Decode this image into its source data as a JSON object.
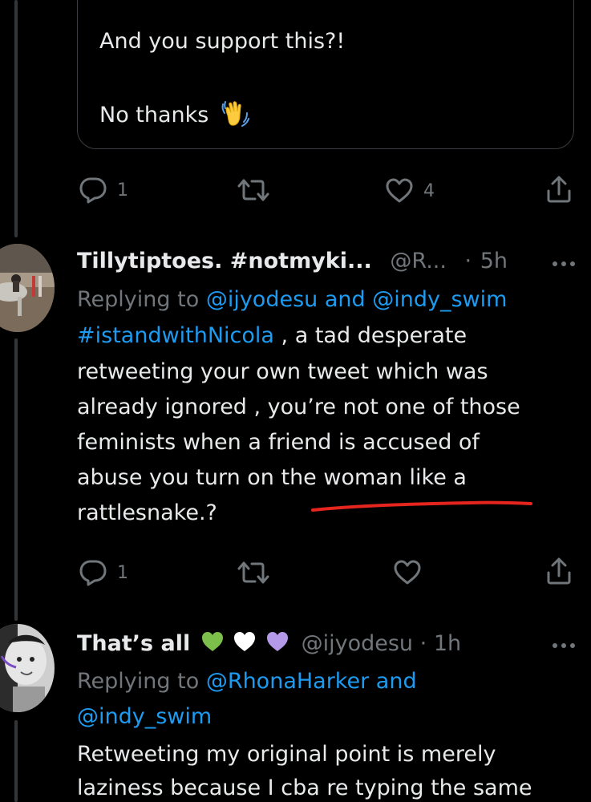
{
  "quoted_tweet": {
    "line1": "And you support this?!",
    "line2": "No thanks",
    "emoji": "waving-hand-icon"
  },
  "tweet1_actions": {
    "reply_count": "1",
    "like_count": "4"
  },
  "tweet2": {
    "name": "Tillytiptoes. #notmyki...",
    "handle": "@R...",
    "separator": "·",
    "time": "5h",
    "replying_label": "Replying to",
    "replying_user1": "@ijyodesu",
    "replying_and": "and",
    "replying_user2": "@indy_swim",
    "hashtag": "#istandwithNicola",
    "lines": [
      " , a tad desperate",
      "retweeting your own tweet which was",
      "already ignored , you’re not one of those",
      "feminists when a friend is accused of",
      "abuse you turn on the woman like a",
      "rattlesnake.?"
    ],
    "reply_count": "1",
    "annotation_color": "#e5251e"
  },
  "tweet3": {
    "name": "That’s all",
    "hearts": [
      "#7cc04b",
      "#ffffff",
      "#b499e8"
    ],
    "handle": "@ijyodesu",
    "separator": "·",
    "time": "1h",
    "replying_label": "Replying to",
    "replying_user1": "@RhonaHarker",
    "replying_and": "and",
    "replying_user2": "@indy_swim",
    "lines": [
      "Retweeting my original point is merely",
      "laziness because I cba re typing the same"
    ]
  },
  "colors": {
    "background": "#000000",
    "text": "#e7e9ea",
    "muted": "#71767b",
    "link": "#1d9bf0"
  }
}
